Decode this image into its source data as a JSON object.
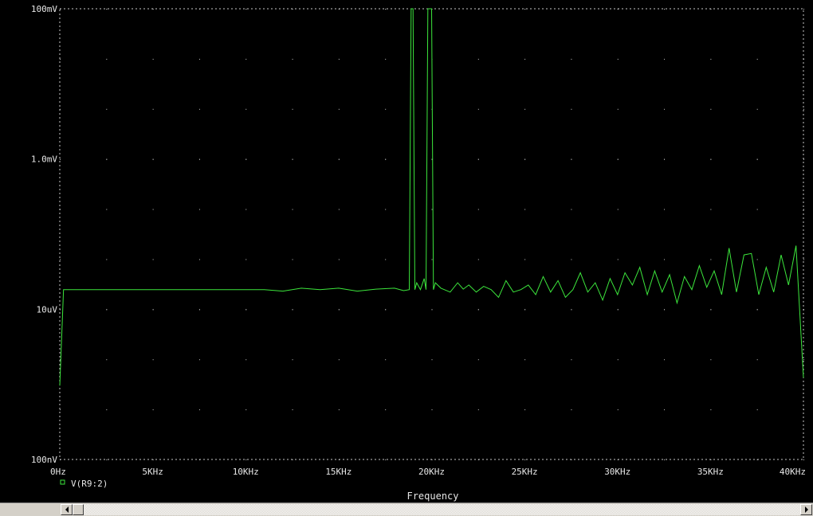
{
  "colors": {
    "background": "#000000",
    "trace": "#3ce63c",
    "grid": "#c8c8c8",
    "text": "#e6e6e6"
  },
  "chart_data": {
    "type": "line",
    "title": "",
    "xlabel": "Frequency",
    "ylabel": "",
    "xlim": [
      0,
      40000
    ],
    "ylim": [
      1e-07,
      0.0001
    ],
    "yscale": "log",
    "grid": true,
    "x_ticks": [
      0,
      5000,
      10000,
      15000,
      20000,
      25000,
      30000,
      35000,
      40000
    ],
    "x_tick_labels": [
      "0Hz",
      "5KHz",
      "10KHz",
      "15KHz",
      "20KHz",
      "25KHz",
      "30KHz",
      "35KHz",
      "40KHz"
    ],
    "y_ticks": [
      1e-07,
      1e-06,
      1e-05,
      0.0001
    ],
    "y_tick_labels": [
      "100nV",
      "10uV",
      "1.0mV",
      "100mV"
    ],
    "legend": {
      "placement": "bottom-left",
      "entries": [
        "V(R9:2)"
      ]
    },
    "series": [
      {
        "name": "V(R9:2)",
        "x": [
          0,
          200,
          250,
          5000,
          10000,
          11000,
          12000,
          13000,
          14000,
          15000,
          16000,
          17000,
          18000,
          18500,
          18800,
          18900,
          19000,
          19100,
          19200,
          19400,
          19600,
          19700,
          19800,
          19900,
          20000,
          20100,
          20200,
          20500,
          21000,
          21400,
          21700,
          22000,
          22400,
          22800,
          23200,
          23600,
          24000,
          24400,
          24800,
          25200,
          25600,
          26000,
          26400,
          26800,
          27200,
          27600,
          28000,
          28400,
          28800,
          29200,
          29600,
          30000,
          30400,
          30800,
          31200,
          31600,
          32000,
          32400,
          32800,
          33200,
          33600,
          34000,
          34400,
          34800,
          35200,
          35600,
          36000,
          36400,
          36800,
          37200,
          37600,
          38000,
          38400,
          38800,
          39200,
          39600,
          40000
        ],
        "y": [
          3.1e-07,
          1.35e-06,
          1.35e-06,
          1.35e-06,
          1.35e-06,
          1.35e-06,
          1.32e-06,
          1.38e-06,
          1.35e-06,
          1.38e-06,
          1.32e-06,
          1.36e-06,
          1.38e-06,
          1.33e-06,
          1.35e-06,
          0.0001,
          0.0001,
          1.35e-06,
          1.5e-06,
          1.35e-06,
          1.6e-06,
          1.35e-06,
          0.0001,
          0.0001,
          0.0001,
          1.35e-06,
          1.5e-06,
          1.38e-06,
          1.3e-06,
          1.5e-06,
          1.36e-06,
          1.45e-06,
          1.3e-06,
          1.42e-06,
          1.35e-06,
          1.2e-06,
          1.55e-06,
          1.3e-06,
          1.35e-06,
          1.45e-06,
          1.25e-06,
          1.65e-06,
          1.3e-06,
          1.55e-06,
          1.2e-06,
          1.35e-06,
          1.75e-06,
          1.3e-06,
          1.5e-06,
          1.15e-06,
          1.6e-06,
          1.25e-06,
          1.75e-06,
          1.45e-06,
          1.9e-06,
          1.25e-06,
          1.8e-06,
          1.3e-06,
          1.7e-06,
          1.1e-06,
          1.65e-06,
          1.35e-06,
          1.95e-06,
          1.4e-06,
          1.8e-06,
          1.25e-06,
          2.55e-06,
          1.3e-06,
          2.3e-06,
          2.35e-06,
          1.25e-06,
          1.9e-06,
          1.3e-06,
          2.3e-06,
          1.45e-06,
          2.65e-06,
          3.5e-07
        ]
      }
    ]
  }
}
